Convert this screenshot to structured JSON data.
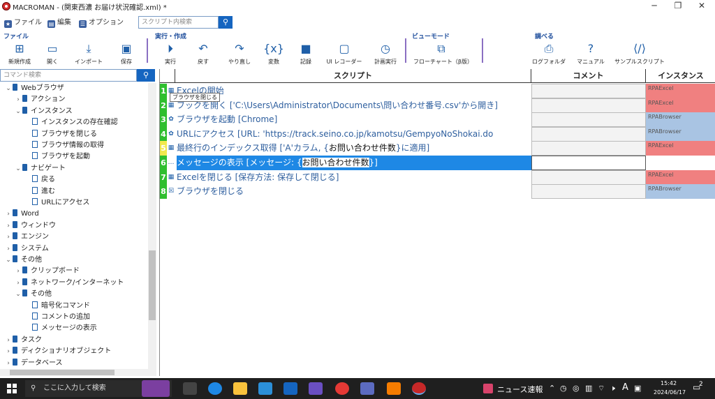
{
  "window": {
    "title": "MACROMAN - (関東西濃 お届け状況確認.xml) *",
    "minimize_glyph": "─",
    "maximize_glyph": "❐",
    "close_glyph": "✕"
  },
  "menu": {
    "file": "ファイル",
    "edit": "編集",
    "options": "オプション",
    "search_placeholder": "スクリプト内検索"
  },
  "ribbon": {
    "groups": {
      "file": "ファイル",
      "run": "実行・作成",
      "view": "ビューモード",
      "check": "調べる"
    },
    "buttons": {
      "new": "新規作成",
      "open": "開く",
      "import": "インポート",
      "save": "保存",
      "run": "実行",
      "undo": "戻す",
      "redo": "やり直し",
      "variables": "変数",
      "record": "記録",
      "ui_recorder": "UI レコーダー",
      "plan_run": "計画実行",
      "flowchart": "フローチャート（β版）",
      "log_folder": "ログフォルダ",
      "manual": "マニュアル",
      "sample_script": "サンプルスクリプト"
    }
  },
  "command_panel": {
    "search_placeholder": "コマンド検索",
    "tree": [
      {
        "label": "Webブラウザ",
        "level": 0,
        "expanded": true,
        "leaf": false
      },
      {
        "label": "アクション",
        "level": 1,
        "expanded": false,
        "leaf": false
      },
      {
        "label": "インスタンス",
        "level": 1,
        "expanded": true,
        "leaf": false
      },
      {
        "label": "インスタンスの存在確認",
        "level": 2,
        "leaf": true
      },
      {
        "label": "ブラウザを閉じる",
        "level": 2,
        "leaf": true
      },
      {
        "label": "ブラウザ情報の取得",
        "level": 2,
        "leaf": true
      },
      {
        "label": "ブラウザを起動",
        "level": 2,
        "leaf": true
      },
      {
        "label": "ナビゲート",
        "level": 1,
        "expanded": true,
        "leaf": false
      },
      {
        "label": "戻る",
        "level": 2,
        "leaf": true
      },
      {
        "label": "進む",
        "level": 2,
        "leaf": true
      },
      {
        "label": "URLにアクセス",
        "level": 2,
        "leaf": true
      },
      {
        "label": "Word",
        "level": 0,
        "expanded": false,
        "leaf": false
      },
      {
        "label": "ウィンドウ",
        "level": 0,
        "expanded": false,
        "leaf": false
      },
      {
        "label": "エンジン",
        "level": 0,
        "expanded": false,
        "leaf": false
      },
      {
        "label": "システム",
        "level": 0,
        "expanded": false,
        "leaf": false
      },
      {
        "label": "その他",
        "level": 0,
        "expanded": true,
        "leaf": false
      },
      {
        "label": "クリップボード",
        "level": 1,
        "expanded": false,
        "leaf": false
      },
      {
        "label": "ネットワーク/インターネット",
        "level": 1,
        "expanded": false,
        "leaf": false
      },
      {
        "label": "その他",
        "level": 1,
        "expanded": true,
        "leaf": false
      },
      {
        "label": "暗号化コマンド",
        "level": 2,
        "leaf": true
      },
      {
        "label": "コメントの追加",
        "level": 2,
        "leaf": true
      },
      {
        "label": "メッセージの表示",
        "level": 2,
        "leaf": true
      },
      {
        "label": "タスク",
        "level": 0,
        "expanded": false,
        "leaf": false
      },
      {
        "label": "ディクショナリオブジェクト",
        "level": 0,
        "expanded": false,
        "leaf": false
      },
      {
        "label": "データベース",
        "level": 0,
        "expanded": false,
        "leaf": false
      }
    ]
  },
  "script_grid": {
    "headers": {
      "script": "スクリプト",
      "comment": "コメント",
      "instance": "インスタンス"
    },
    "tooltip": "ブラウザを閉じる",
    "rows": [
      {
        "num": "1",
        "text": "Excelの開始",
        "highlight": "",
        "suffix": "",
        "instance": "RPAExcel",
        "icon": "table-icon",
        "glyph": "▦",
        "num_color": "#2fbf2f",
        "inst_color": "#f08080"
      },
      {
        "num": "2",
        "text": "ブックを開く ['C:\\Users\\Administrator\\Documents\\問い合わせ番号.csv'から開き]",
        "highlight": "",
        "suffix": "",
        "instance": "RPAExcel",
        "icon": "table-icon",
        "glyph": "▦",
        "num_color": "#2fbf2f",
        "inst_color": "#f08080"
      },
      {
        "num": "3",
        "text": "ブラウザを起動 [Chrome]",
        "highlight": "",
        "suffix": "",
        "instance": "RPABrowser",
        "icon": "browser-icon",
        "glyph": "✿",
        "num_color": "#2fbf2f",
        "inst_color": "#a9c4e3"
      },
      {
        "num": "4",
        "text": "URLにアクセス [URL: 'https://track.seino.co.jp/kamotsu/GempyoNoShokai.do",
        "highlight": "",
        "suffix": "",
        "instance": "RPABrowser",
        "icon": "browser-icon",
        "glyph": "✿",
        "num_color": "#2fbf2f",
        "inst_color": "#a9c4e3"
      },
      {
        "num": "5",
        "text": "最終行のインデックス取得 ['A'カラム, {",
        "highlight": "お問い合わせ件数",
        "suffix": "}に適用]",
        "instance": "RPAExcel",
        "icon": "table-icon",
        "glyph": "▦",
        "num_color": "#f2e94e",
        "inst_color": "#f08080"
      },
      {
        "num": "6",
        "text": "メッセージの表示 [メッセージ: {",
        "highlight": "お問い合わせ件数",
        "suffix": "}]",
        "instance": "",
        "icon": "message-icon",
        "glyph": "…",
        "num_color": "#2fbf2f",
        "inst_color": "#ffffff"
      },
      {
        "num": "7",
        "text": "Excelを閉じる [保存方法: 保存して閉じる]",
        "highlight": "",
        "suffix": "",
        "instance": "RPAExcel",
        "icon": "table-icon",
        "glyph": "▦",
        "num_color": "#2fbf2f",
        "inst_color": "#f08080"
      },
      {
        "num": "8",
        "text": "ブラウザを閉じる",
        "highlight": "",
        "suffix": "",
        "instance": "RPABrowser",
        "icon": "close-browser-icon",
        "glyph": "☒",
        "num_color": "#2fbf2f",
        "inst_color": "#a9c4e3"
      }
    ]
  },
  "taskbar": {
    "search_placeholder": "ここに入力して検索",
    "news": "ニュース速報",
    "time": "15:42",
    "date": "2024/06/17",
    "ime": "A",
    "notification_count": "2"
  },
  "colors": {
    "accent": "#1565c0",
    "ribbon_group": "#1f4e9c",
    "selection": "#1e88e5"
  }
}
